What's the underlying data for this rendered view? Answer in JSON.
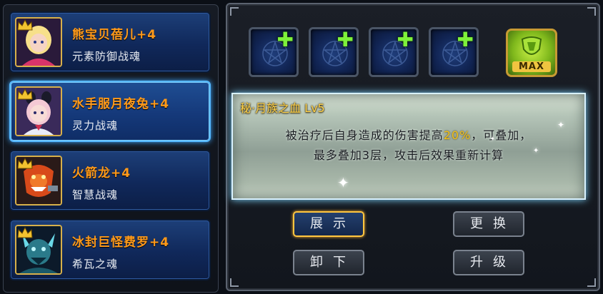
{
  "souls": [
    {
      "name": "熊宝贝蓓儿+4",
      "type": "元素防御战魂",
      "icon": "doll-girl-portrait",
      "selected": false
    },
    {
      "name": "水手服月夜兔+4",
      "type": "灵力战魂",
      "icon": "sailor-bunny-portrait",
      "selected": true
    },
    {
      "name": "火箭龙+4",
      "type": "智慧战魂",
      "icon": "rocket-dragon-portrait",
      "selected": false
    },
    {
      "name": "冰封巨怪费罗+4",
      "type": "希瓦之魂",
      "icon": "ice-monster-portrait",
      "selected": false
    }
  ],
  "slots": [
    {
      "icon": "pentagram-rune-icon",
      "action": "plus-icon"
    },
    {
      "icon": "pentagram-rune-icon",
      "action": "plus-icon"
    },
    {
      "icon": "pentagram-rune-icon",
      "action": "plus-icon"
    },
    {
      "icon": "pentagram-rune-icon",
      "action": "plus-icon"
    }
  ],
  "max_badge": {
    "label": "MAX",
    "icon": "green-emblem-icon"
  },
  "skill": {
    "title": "秘·月族之血 Lv5",
    "desc_line1_pre": "被治疗后自身造成的伤害提高",
    "desc_highlight": "20%",
    "desc_line1_post": "，可叠加，",
    "desc_line2": "最多叠加3层，攻击后效果重新计算"
  },
  "buttons": {
    "show": "展示",
    "replace": "更换",
    "unequip": "卸下",
    "upgrade": "升级"
  },
  "colors": {
    "name_orange": "#ff9a1a",
    "highlight_yellow": "#f2c21a",
    "plus_green": "#7ef23a",
    "selected_border": "#56b8ff"
  }
}
